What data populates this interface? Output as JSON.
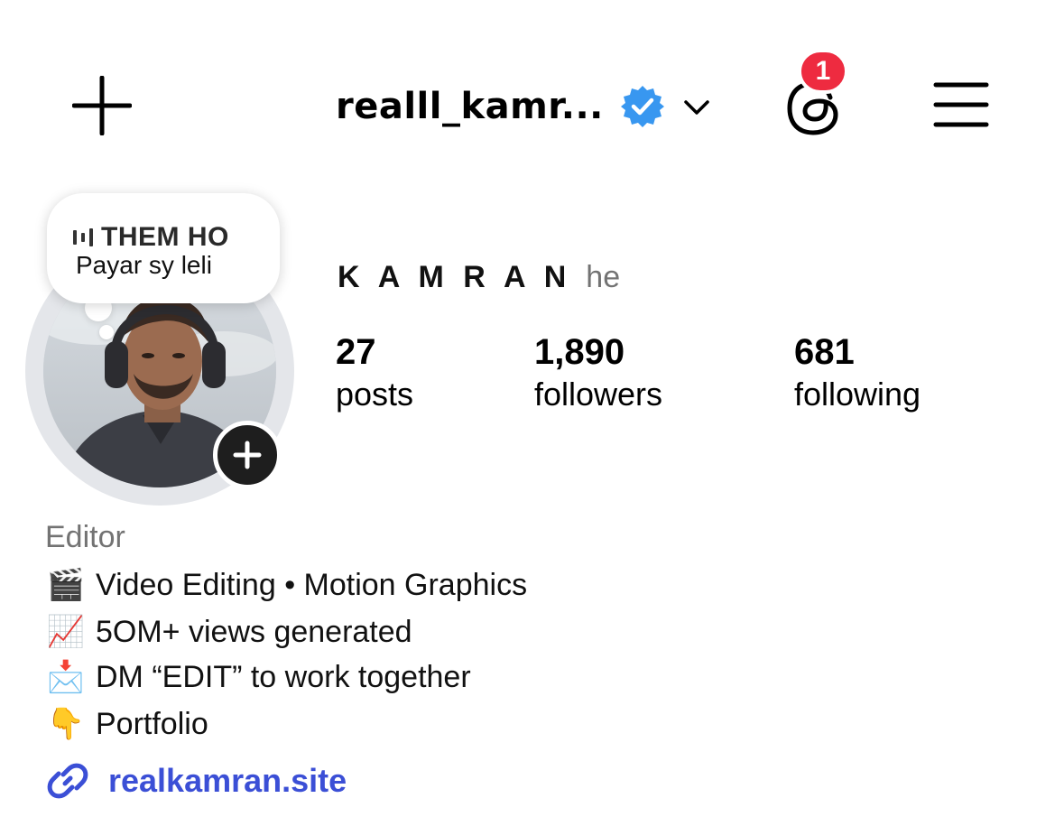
{
  "header": {
    "username": "realll_kamr...",
    "notification_count": "1",
    "icons": [
      "plus-icon",
      "verified-badge-icon",
      "chevron-down-icon",
      "threads-icon",
      "hamburger-menu-icon"
    ]
  },
  "note": {
    "song": "THEM HO",
    "text": "Payar sy leli"
  },
  "profile": {
    "display_name": "K A M R A N",
    "pronouns": "he",
    "stats": [
      {
        "value": "27",
        "label": "posts"
      },
      {
        "value": "1,890",
        "label": "followers"
      },
      {
        "value": "681",
        "label": "following"
      }
    ]
  },
  "bio": {
    "category": "Editor",
    "lines": [
      {
        "emoji": "🎬",
        "text": "Video Editing • Motion Graphics"
      },
      {
        "emoji": "📈",
        "text": "5OM+ views generated"
      },
      {
        "emoji": "📩",
        "text": "DM “EDIT” to work together"
      },
      {
        "emoji": "👇",
        "text": "Portfolio"
      }
    ],
    "link": "realkamran.site"
  },
  "colors": {
    "verified": "#3897f0",
    "badge": "#ee2b40",
    "link": "#3b4fd6",
    "muted": "#737373"
  }
}
